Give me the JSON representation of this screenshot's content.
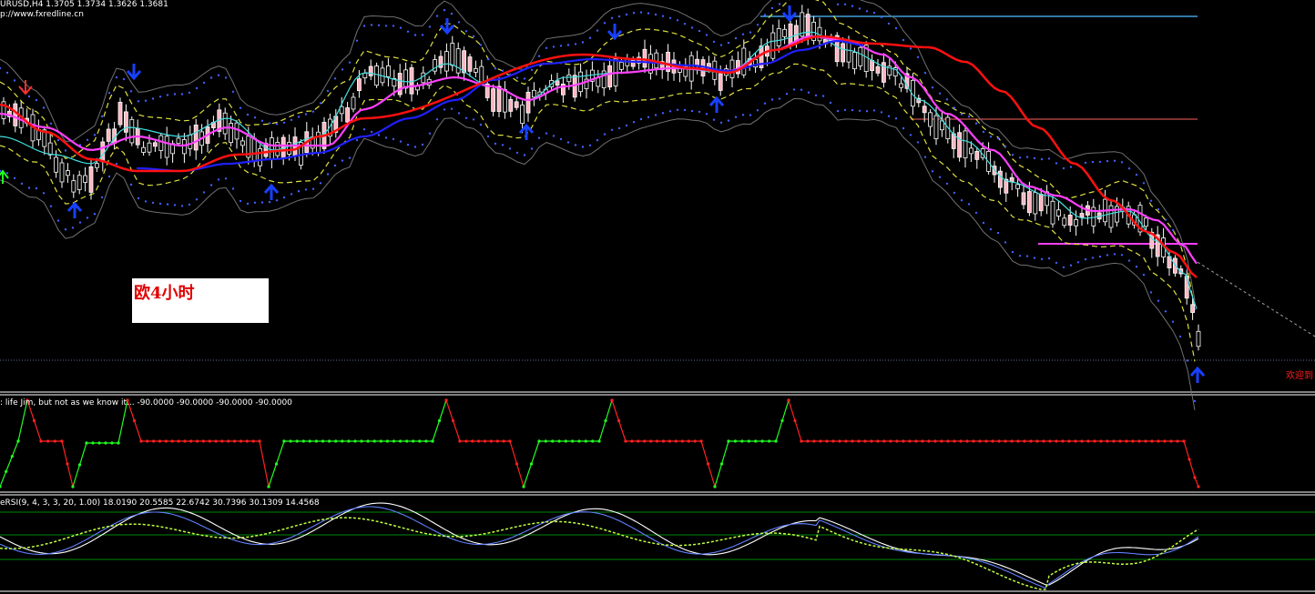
{
  "main_panel": {
    "header_line1": "URUSD,H4  1.3705 1.3734 1.3626 1.3681",
    "header_line2": "p://www.fxredline.cn",
    "label_box_text": "欧4小时",
    "right_text": "欢迎到"
  },
  "sub_panel_1": {
    "header": ": life Jim, but not as we know it... -90.0000 -90.0000 -90.0000 -90.0000"
  },
  "sub_panel_2": {
    "header": "eRSI(9, 4, 3, 3, 20, 1.00) 18.0190 20.5585 22.6742 30.7396 30.1309 14.4568"
  },
  "colors": {
    "background": "#000000",
    "bull_candle": "#000000",
    "bear_candle": "#ffb6c1",
    "wick": "#ffffff",
    "red_ma": "#ff1010",
    "magenta_ma": "#ff40ff",
    "blue_ma": "#2020ff",
    "cyan_ma": "#40e0e0",
    "yellow_band": "#e0e040",
    "arrow_up": "#1840ff",
    "arrow_down": "#1840ff",
    "stair_green": "#20ff20",
    "stair_red": "#ff2020",
    "rsi_white": "#ffffff",
    "rsi_blue": "#6080ff",
    "rsi_yellowgreen": "#c0ff40",
    "grid_green": "#008800"
  },
  "chart_data": [
    {
      "type": "candlestick",
      "title": "URUSD,H4  1.3705 1.3734 1.3626 1.3681",
      "symbol": "URUSD",
      "timeframe": "H4",
      "last_bar": {
        "open": 1.3705,
        "high": 1.3734,
        "low": 1.3626,
        "close": 1.3681
      },
      "indicators": [
        "red moving average",
        "magenta moving average",
        "blue moving average",
        "cyan moving average",
        "yellow dashed envelope bands",
        "blue dotted envelope bands",
        "gray channel",
        "up/down arrow signals"
      ],
      "down_arrows": 6,
      "up_arrows": 7,
      "grid": false
    },
    {
      "type": "line",
      "title": ": life Jim, but not as we know it... -90.0000 -90.0000 -90.0000 -90.0000",
      "values_shown": [
        -90.0,
        -90.0,
        -90.0,
        -90.0
      ],
      "series": [
        {
          "name": "up",
          "color": "green"
        },
        {
          "name": "down",
          "color": "red"
        }
      ]
    },
    {
      "type": "line",
      "title": "eRSI(9, 4, 3, 3, 20, 1.00) 18.0190 20.5585 22.6742 30.7396 30.1309 14.4568",
      "parameters": [
        9,
        4,
        3,
        3,
        20,
        1.0
      ],
      "values_shown": [
        18.019,
        20.5585,
        22.6742,
        30.7396,
        30.1309,
        14.4568
      ]
    }
  ]
}
